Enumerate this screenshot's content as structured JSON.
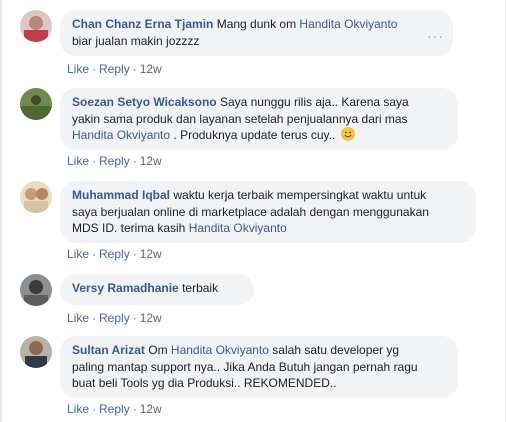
{
  "comments": [
    {
      "author": "Chan Chanz Erna Tjamin",
      "segments": [
        "Mang dunk om ",
        "Handita Okviyanto",
        " biar jualan makin jozzzz"
      ],
      "line1_pre": "Mang dunk om ",
      "mention": "Handita Okviyanto",
      "line2": "biar jualan makin jozzzz",
      "like": "Like",
      "reply": "Reply",
      "time": "12w",
      "more": "···"
    },
    {
      "author": "Soezan Setyo Wicaksono",
      "line1_post": " Saya nunggu rilis aja.. Karena saya",
      "line2": "yakin sama produk dan layanan setelah penjualannya dari mas",
      "mention": "Handita Okviyanto",
      "line3_post": " . Produknya update terus cuy..",
      "emoji": "smiley-emoji",
      "like": "Like",
      "reply": "Reply",
      "time": "12w"
    },
    {
      "author": "Muhammad Iqbal",
      "line1_post": " waktu kerja terbaik mempersingkat waktu untuk",
      "line2": "saya berjualan online di marketplace adalah dengan menggunakan",
      "line3_pre": "MDS ID. terima kasih ",
      "mention": "Handita Okviyanto",
      "like": "Like",
      "reply": "Reply",
      "time": "12w"
    },
    {
      "author": "Versy Ramadhanie",
      "line1_post": " terbaik",
      "like": "Like",
      "reply": "Reply",
      "time": "12w"
    },
    {
      "author": "Sultan Arizat",
      "line1_mid": " Om ",
      "mention": "Handita Okviyanto",
      "line1_post": " salah satu developer yg",
      "line2": "paling mantap support nya.. Jika Anda Butuh jangan pernah ragu",
      "line3": "buat beli Tools yg dia Produksi.. REKOMENDED..",
      "like": "Like",
      "reply": "Reply",
      "time": "12w"
    }
  ],
  "colors": {
    "link": "#385898",
    "bubble": "#f2f3f5",
    "meta": "#606770",
    "action": "#4267b2"
  }
}
